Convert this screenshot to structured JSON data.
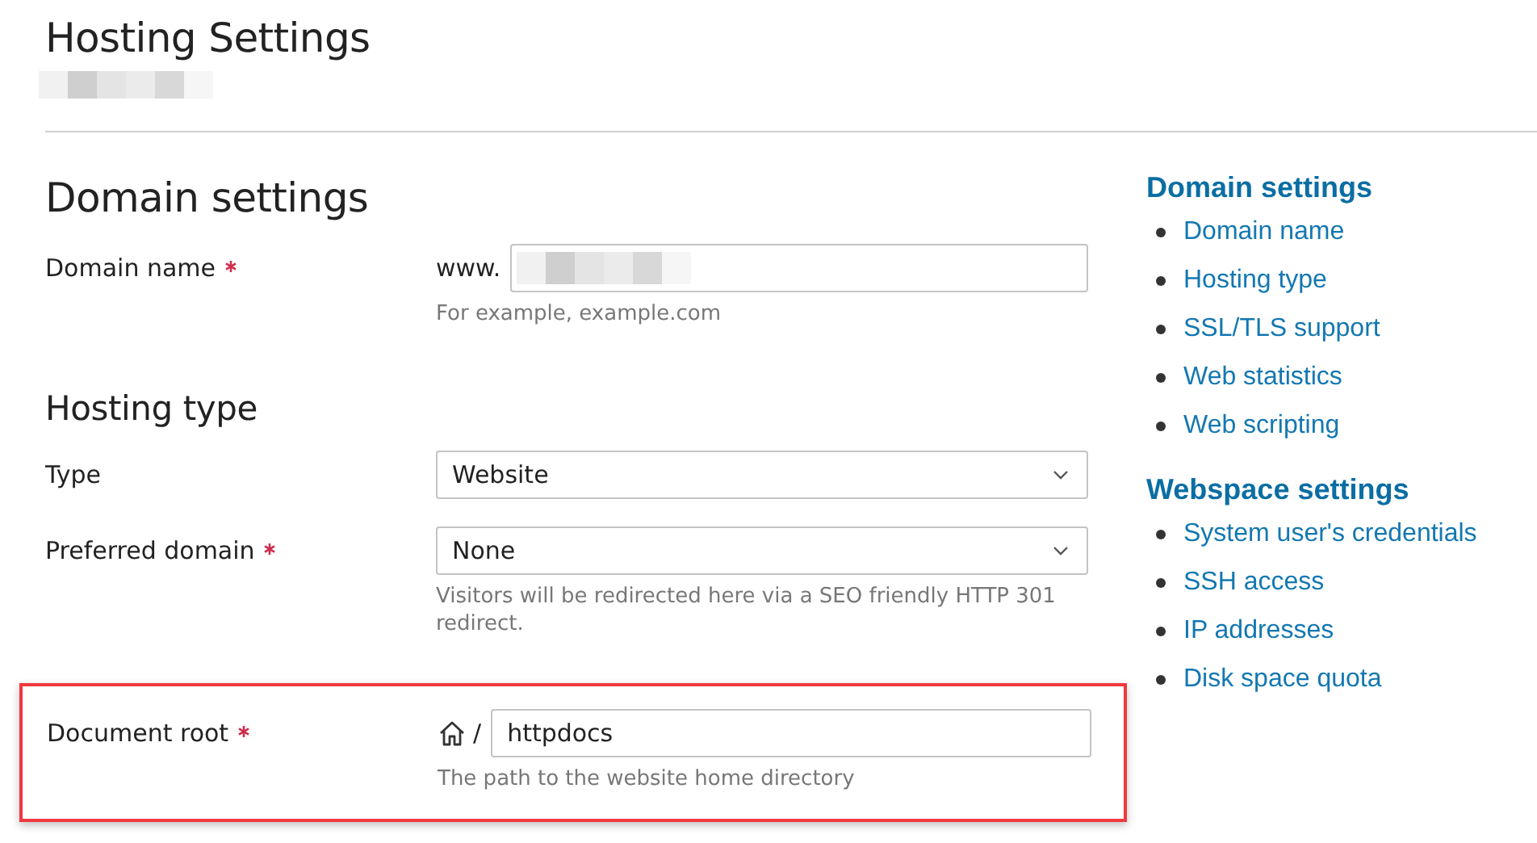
{
  "page": {
    "title": "Hosting Settings",
    "subtitle_redacted": true
  },
  "sections": [
    {
      "heading": "Domain settings",
      "kind": "h2",
      "fields": [
        {
          "kind": "text",
          "label": "Domain name",
          "required": true,
          "prefix": "www.",
          "value_redacted": true,
          "hint": "For example, example.com",
          "highlighted": false
        }
      ]
    },
    {
      "heading": "Hosting type",
      "kind": "h3",
      "fields": [
        {
          "kind": "select",
          "label": "Type",
          "required": false,
          "value": "Website",
          "highlighted": false
        },
        {
          "kind": "select",
          "label": "Preferred domain",
          "required": true,
          "value": "None",
          "hint": "Visitors will be redirected here via a SEO friendly HTTP 301 redirect.",
          "highlighted": false
        },
        {
          "kind": "path",
          "label": "Document root",
          "required": true,
          "prefix": "/",
          "value": "httpdocs",
          "hint": "The path to the website home directory",
          "highlighted": true
        }
      ]
    }
  ],
  "sidebar": [
    {
      "heading": "Domain settings",
      "links": [
        "Domain name",
        "Hosting type",
        "SSL/TLS support",
        "Web statistics",
        "Web scripting"
      ]
    },
    {
      "heading": "Webspace settings",
      "links": [
        "System user's credentials",
        "SSH access",
        "IP addresses",
        "Disk space quota"
      ]
    }
  ]
}
